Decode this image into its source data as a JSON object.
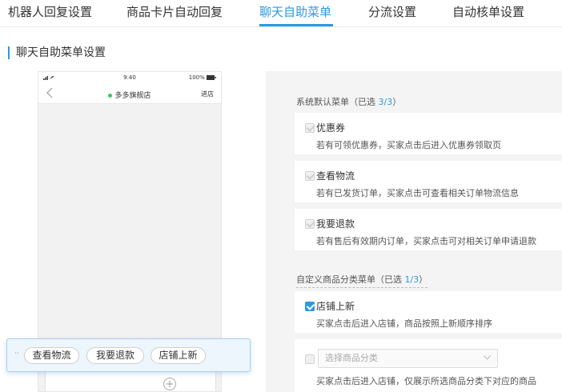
{
  "tabs": [
    {
      "label": "机器人回复设置",
      "active": false
    },
    {
      "label": "商品卡片自动回复",
      "active": false
    },
    {
      "label": "聊天自助菜单",
      "active": true
    },
    {
      "label": "分流设置",
      "active": false
    },
    {
      "label": "自动核单设置",
      "active": false
    }
  ],
  "section_title": "聊天自助菜单设置",
  "phone": {
    "time": "9:40",
    "battery": "100%",
    "shop_name": "多多旗舰店",
    "enter_shop": "进店"
  },
  "quick_menu": {
    "dots": "··",
    "items": [
      "查看物流",
      "我要退款",
      "店铺上新"
    ]
  },
  "system_menu": {
    "title_prefix": "系统默认菜单（已选 ",
    "count": "3/3",
    "title_suffix": "）",
    "items": [
      {
        "name": "优惠券",
        "desc": "若有可领优惠券，买家点击后进入优惠券领取页"
      },
      {
        "name": "查看物流",
        "desc": "若有已发货订单，买家点击可查看相关订单物流信息"
      },
      {
        "name": "我要退款",
        "desc": "若有售后有效期内订单，买家点击可对相关订单申请退款"
      }
    ]
  },
  "custom_menu": {
    "title_prefix": "自定义商品分类菜单（已选 ",
    "count": "1/3",
    "title_suffix": "）",
    "items": [
      {
        "name": "店铺上新",
        "desc": "买家点击后进入店铺，商品按照上新顺序排序",
        "checked": true
      },
      {
        "select_placeholder": "选择商品分类",
        "desc": "买家点击后进入店铺，仅展示所选商品分类下对应的商品",
        "checked": false
      }
    ]
  },
  "colors": {
    "accent": "#2b9ae0",
    "online_dot": "#46c15b"
  }
}
